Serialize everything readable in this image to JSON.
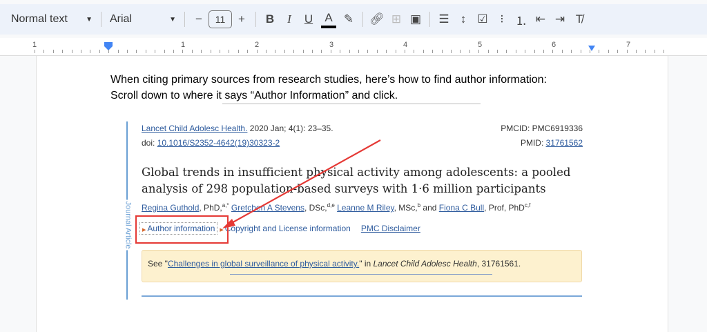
{
  "toolbar": {
    "style": "Normal text",
    "font": "Arial",
    "font_size": "11",
    "decrease": "−",
    "increase": "+",
    "bold": "B",
    "italic": "I",
    "underline": "U",
    "text_color": "A"
  },
  "ruler": {
    "labels": [
      "1",
      "1",
      "2",
      "3",
      "4",
      "5",
      "6",
      "7"
    ]
  },
  "doc": {
    "line1": "When citing primary sources from research studies, here’s how to find author information:",
    "line2": "Scroll down to where it says “Author Information” and click."
  },
  "article": {
    "side_label": "Journal Article",
    "journal": "Lancet Child Adolesc Health.",
    "date": " 2020 Jan; 4(1): 23–35.",
    "doi_label": "doi: ",
    "doi": "10.1016/S2352-4642(19)30323-2",
    "pmcid": "PMCID: PMC6919336",
    "pmid_label": "PMID: ",
    "pmid": "31761562",
    "title": "Global trends in insufficient physical activity among adolescents: a pooled analysis of 298 population-based surveys with 1·6 million participants",
    "authors": [
      {
        "name": "Regina Guthold",
        "deg": ", PhD,",
        "sup": "a,*"
      },
      {
        "name": "Gretchen A Stevens",
        "deg": ", DSc,",
        "sup": "d,e"
      },
      {
        "name": "Leanne M Riley",
        "deg": ", MSc,",
        "sup": "b"
      },
      {
        "name": "Fiona C Bull",
        "deg": ", Prof, PhD",
        "sup": "c,f"
      }
    ],
    "and": " and ",
    "links": [
      "Author information",
      "Copyright and License information",
      "PMC Disclaimer"
    ],
    "notice": {
      "prefix": "See \"",
      "link": "Challenges in global surveillance of physical activity.",
      "mid": "\" in ",
      "journal": "Lancet Child Adolesc Health",
      "suffix": ", 31761561."
    }
  },
  "annotation": {
    "color": "#e53935"
  }
}
